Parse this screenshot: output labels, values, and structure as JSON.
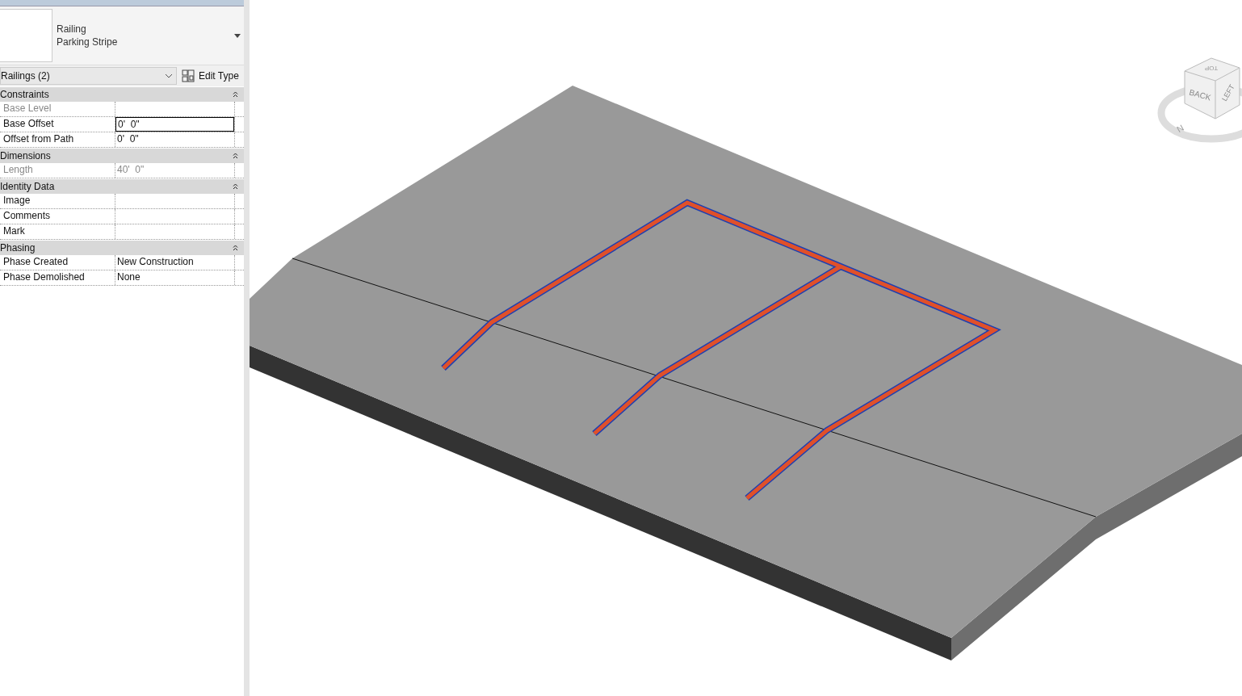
{
  "type_selector": {
    "category": "Railing",
    "type_name": "Parking Stripe"
  },
  "instance_filter": {
    "value": "Railings (2)"
  },
  "edit_type_button": {
    "label": "Edit Type"
  },
  "groups": [
    {
      "title": "Constraints",
      "expanded": true,
      "rows": [
        {
          "name": "Base Level",
          "disabled": true,
          "editing": false
        },
        {
          "name": "Base Offset",
          "value": "0'  0\"",
          "disabled": false,
          "editing": true
        },
        {
          "name": "Offset from Path",
          "value": "0'  0\"",
          "disabled": false,
          "editing": false
        }
      ]
    },
    {
      "title": "Dimensions",
      "expanded": true,
      "rows": [
        {
          "name": "Length",
          "value": "40'  0\"",
          "disabled": true,
          "editing": false
        }
      ]
    },
    {
      "title": "Identity Data",
      "expanded": true,
      "rows": [
        {
          "name": "Image",
          "disabled": false,
          "editing": false
        },
        {
          "name": "Comments",
          "disabled": false,
          "editing": false
        },
        {
          "name": "Mark",
          "disabled": false,
          "editing": false
        }
      ]
    },
    {
      "title": "Phasing",
      "expanded": true,
      "rows": [
        {
          "name": "Phase Created",
          "value": "New Construction",
          "disabled": false,
          "editing": false
        },
        {
          "name": "Phase Demolished",
          "value": "None",
          "disabled": false,
          "editing": false
        }
      ]
    }
  ],
  "view_cube": {
    "top": "TOP",
    "back": "BACK",
    "left": "LEFT",
    "compass": "N"
  }
}
